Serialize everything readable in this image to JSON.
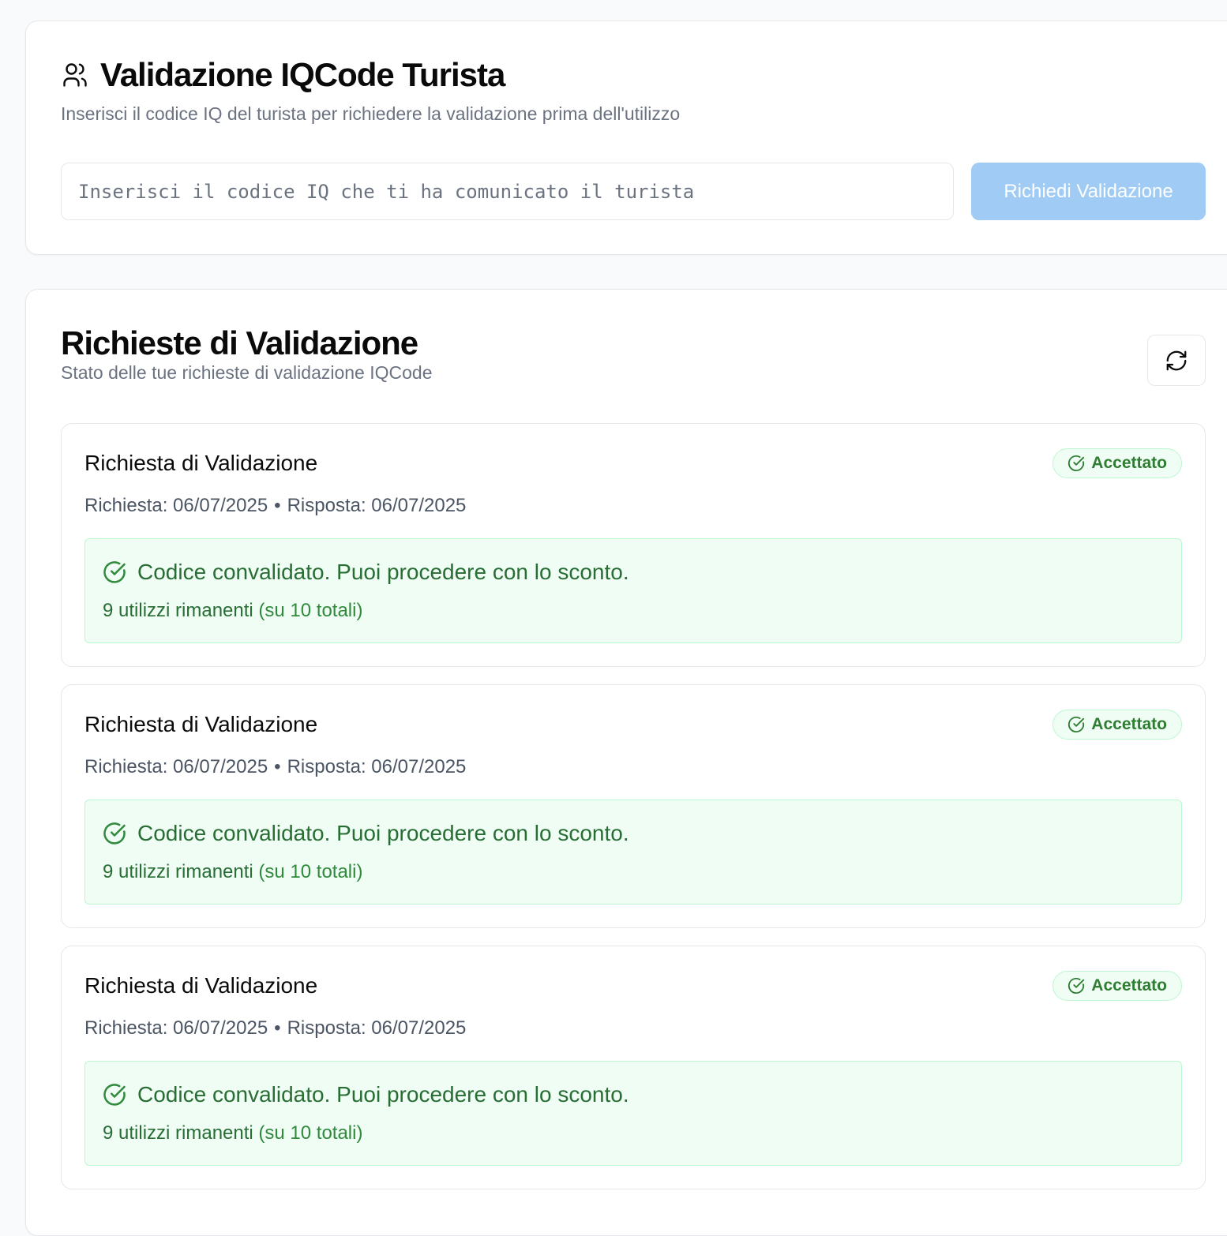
{
  "validation_form": {
    "title": "Validazione IQCode Turista",
    "subtitle": "Inserisci il codice IQ del turista per richiedere la validazione prima dell'utilizzo",
    "input_value": "",
    "input_placeholder": "Inserisci il codice IQ che ti ha comunicato il turista",
    "submit_label": "Richiedi Validazione",
    "submit_color": "#9fcbf4"
  },
  "requests_panel": {
    "title": "Richieste di Validazione",
    "subtitle": "Stato delle tue richieste di validazione IQCode",
    "refresh_icon": "refresh-icon",
    "items": [
      {
        "title": "Richiesta di Validazione",
        "status": "Accettato",
        "requested": "Richiesta: 06/07/2025",
        "separator": "•",
        "answered": "Risposta: 06/07/2025",
        "message": "Codice convalidato. Puoi procedere con lo sconto.",
        "remaining": "9 utilizzi rimanenti",
        "total": "(su 10 totali)"
      },
      {
        "title": "Richiesta di Validazione",
        "status": "Accettato",
        "requested": "Richiesta: 06/07/2025",
        "separator": "•",
        "answered": "Risposta: 06/07/2025",
        "message": "Codice convalidato. Puoi procedere con lo sconto.",
        "remaining": "9 utilizzi rimanenti",
        "total": "(su 10 totali)"
      },
      {
        "title": "Richiesta di Validazione",
        "status": "Accettato",
        "requested": "Richiesta: 06/07/2025",
        "separator": "•",
        "answered": "Risposta: 06/07/2025",
        "message": "Codice convalidato. Puoi procedere con lo sconto.",
        "remaining": "9 utilizzi rimanenti",
        "total": "(su 10 totali)"
      }
    ]
  },
  "colors": {
    "success_text": "#276d34",
    "success_bg": "#f0fdf4",
    "success_border": "#bbf7d0",
    "muted_text": "#6b7280"
  }
}
